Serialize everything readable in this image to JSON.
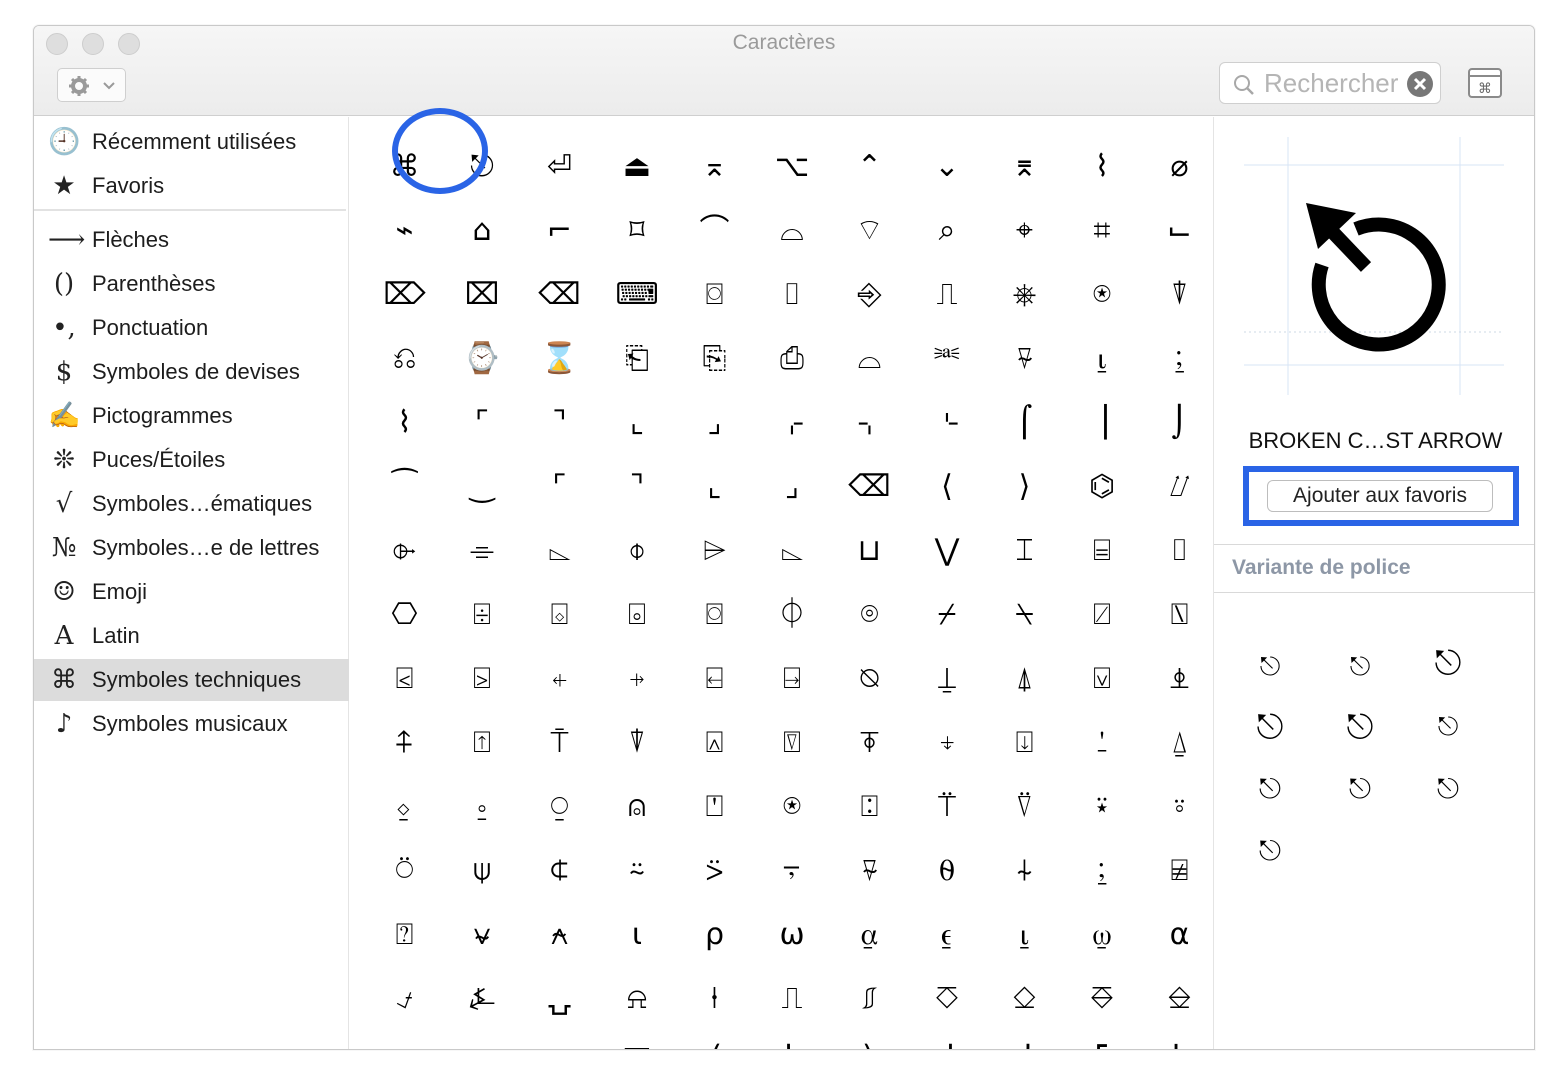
{
  "window": {
    "title": "Caractères"
  },
  "toolbar": {
    "gear_icon": "gear-icon",
    "search_placeholder": "Rechercher",
    "clear_icon": "clear-icon",
    "viewer_icon": "character-viewer-icon"
  },
  "sidebar": {
    "items": [
      {
        "icon": "🕘",
        "label": "Récemment utilisées",
        "name": "recent"
      },
      {
        "icon": "★",
        "label": "Favoris",
        "name": "favorites"
      },
      {
        "icon": "⟶",
        "label": "Flèches",
        "name": "arrows"
      },
      {
        "icon": "()",
        "label": "Parenthèses",
        "name": "parentheses"
      },
      {
        "icon": "•,",
        "label": "Ponctuation",
        "name": "punctuation"
      },
      {
        "icon": "$",
        "label": "Symboles de devises",
        "name": "currency"
      },
      {
        "icon": "✍",
        "label": "Pictogrammes",
        "name": "pictographs"
      },
      {
        "icon": "❊",
        "label": "Puces/Étoiles",
        "name": "bullets-stars"
      },
      {
        "icon": "√",
        "label": "Symboles…ématiques",
        "name": "math"
      },
      {
        "icon": "№",
        "label": "Symboles…e de lettres",
        "name": "letterlike"
      },
      {
        "icon": "☺",
        "label": "Emoji",
        "name": "emoji"
      },
      {
        "icon": "A",
        "label": "Latin",
        "name": "latin"
      },
      {
        "icon": "⌘",
        "label": "Symboles techniques",
        "name": "technical"
      },
      {
        "icon": "♪",
        "label": "Symboles musicaux",
        "name": "musical"
      }
    ],
    "selected": "technical"
  },
  "grid": {
    "rows": [
      [
        "⌘",
        "⎋",
        "⏎",
        "⏏",
        "⌅",
        "⌥",
        "⌃",
        "⌄",
        "⌆",
        "⌇",
        "⌀"
      ],
      [
        "⌁",
        "⌂",
        "⌐",
        "⌑",
        "⌒",
        "⌓",
        "⌔",
        "⌕",
        "⌖",
        "⌗",
        "⌙"
      ],
      [
        "⌦",
        "⌧",
        "⌫",
        "⌨",
        "⌼",
        "⌷",
        "⎆",
        "⎍",
        "⎈",
        "⍟",
        "⍒"
      ],
      [
        "⎌",
        "⌚",
        "⌛",
        "⎗",
        "⎘",
        "⎙",
        "⌓",
        "⎃",
        "⍫",
        "⍸",
        "⍮"
      ],
      [
        "⌇",
        "⌜",
        "⌝",
        "⌞",
        "⌟",
        "⌌",
        "⌍",
        "⌎",
        "⌠",
        "⎥",
        "⌡"
      ],
      [
        "⁀",
        "‿",
        "⌜",
        "⌝",
        "⌞",
        "⌟",
        "⌫",
        "⟨",
        "⟩",
        "⌬",
        "⌰"
      ],
      [
        "⌱",
        "⌯",
        "⌳",
        "⌽",
        "⌲",
        "⌳",
        "⊔",
        "⋁",
        "⌶",
        "⌸",
        "⌷"
      ],
      [
        "⎔",
        "⌹",
        "⌺",
        "⌻",
        "⌼",
        "⏀",
        "⌾",
        "⌿",
        "⍀",
        "⍁",
        "⍂"
      ],
      [
        "⍃",
        "⍄",
        "⍅",
        "⍆",
        "⍇",
        "⍈",
        "⍉",
        "⍊",
        "⍋",
        "⍌",
        "⍎"
      ],
      [
        "⍏",
        "⍐",
        "⍑",
        "⍒",
        "⍓",
        "⍔",
        "⍕",
        "⍖",
        "⍗",
        "⍘",
        "⍙"
      ],
      [
        "⍚",
        "⍛",
        "⍜",
        "⍝",
        "⍞",
        "⍟",
        "⍠",
        "⍡",
        "⍢",
        "⍣",
        "⍤"
      ],
      [
        "⍥",
        "⍦",
        "⍧",
        "⍨",
        "⍩",
        "⍪",
        "⍫",
        "⍬",
        "⍭",
        "⍮",
        "⍯"
      ],
      [
        "⍰",
        "⍱",
        "⍲",
        "⍳",
        "⍴",
        "⍵",
        "⍶",
        "⍷",
        "⍸",
        "⍹",
        "⍺"
      ],
      [
        "⍻",
        "⍼",
        "⍽",
        "⍾",
        "⍿",
        "⎍",
        "⎎",
        "⎏",
        "⎐",
        "⎑",
        "⎒"
      ],
      [
        "⎯",
        "⎕",
        "⎖",
        "⎲",
        "⎛",
        "⎝",
        "⎞",
        "⎟",
        "⎠",
        "⎡",
        "⎣"
      ]
    ],
    "selected": "⎋"
  },
  "detail": {
    "preview_char": "⎋",
    "char_name": "BROKEN C…ST ARROW",
    "favorite_button": "Ajouter aux favoris",
    "variant_title": "Variante de police",
    "variants": [
      "⎋",
      "⎋",
      "⎋",
      "⎋",
      "⎋",
      "⎋",
      "⎋",
      "⎋",
      "⎋",
      "⎋"
    ]
  },
  "colors": {
    "accent_ring": "#2a64e6",
    "selection_bg": "#dcdcdc",
    "variant_title": "#8d97a6"
  }
}
